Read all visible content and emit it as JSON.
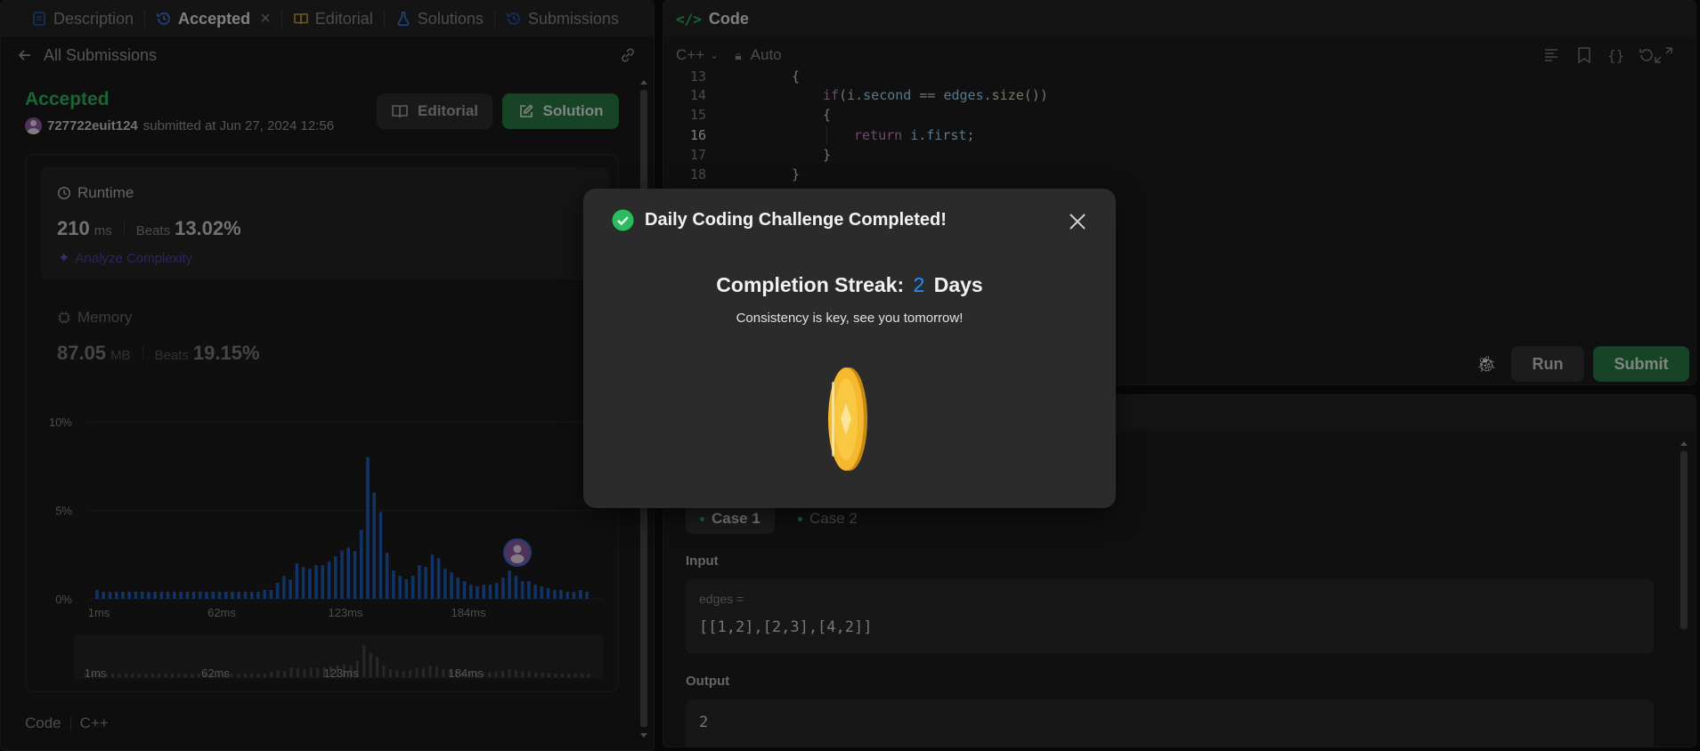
{
  "left_tabs": [
    {
      "label": "Description",
      "icon": "description-icon",
      "active": false
    },
    {
      "label": "Accepted",
      "icon": "history-icon",
      "active": true,
      "closable": true
    },
    {
      "label": "Editorial",
      "icon": "book-icon",
      "active": false
    },
    {
      "label": "Solutions",
      "icon": "flask-icon",
      "active": false
    },
    {
      "label": "Submissions",
      "icon": "history-icon",
      "active": false
    }
  ],
  "submission": {
    "back_label": "All Submissions",
    "status": "Accepted",
    "username": "727722euit124",
    "submitted_text": "submitted at Jun 27, 2024 12:56",
    "editorial_button": "Editorial",
    "solution_button": "Solution"
  },
  "runtime": {
    "label": "Runtime",
    "value": "210",
    "unit": "ms",
    "beats_label": "Beats",
    "beats_value": "13.02%",
    "analyze_label": "Analyze Complexity"
  },
  "memory": {
    "label": "Memory",
    "value": "87.05",
    "unit": "MB",
    "beats_label": "Beats",
    "beats_value": "19.15%"
  },
  "chart_data": {
    "type": "bar",
    "y_ticks": [
      "10%",
      "5%",
      "0%"
    ],
    "ylim": [
      0,
      10
    ],
    "x_ticks": [
      "1ms",
      "62ms",
      "123ms",
      "184ms"
    ],
    "mini_x_ticks": [
      "1ms",
      "62ms",
      "123ms",
      "184ms"
    ],
    "values": [
      0.5,
      0.4,
      0.4,
      0.4,
      0.4,
      0.4,
      0.4,
      0.4,
      0.4,
      0.4,
      0.4,
      0.4,
      0.4,
      0.4,
      0.4,
      0.4,
      0.4,
      0.4,
      0.4,
      0.4,
      0.4,
      0.4,
      0.4,
      0.4,
      0.4,
      0.4,
      0.5,
      0.5,
      0.9,
      1.3,
      1.1,
      2.0,
      1.8,
      1.7,
      1.9,
      1.9,
      2.1,
      2.4,
      2.7,
      2.9,
      2.7,
      3.9,
      8.0,
      6.0,
      4.9,
      2.6,
      1.6,
      1.3,
      1.1,
      1.3,
      1.9,
      1.8,
      2.5,
      2.3,
      1.7,
      1.5,
      1.2,
      1.0,
      0.8,
      0.7,
      0.8,
      0.8,
      0.9,
      1.2,
      1.6,
      1.3,
      1.0,
      1.0,
      0.8,
      0.7,
      0.6,
      0.5,
      0.5,
      0.4,
      0.4,
      0.5,
      0.4
    ],
    "bar_color": "#1e5fbd",
    "highlight_index": 64
  },
  "left_footer": {
    "code_label": "Code",
    "lang_label": "C++"
  },
  "code_panel": {
    "title": "Code",
    "language": "C++",
    "mode": "Auto",
    "lines": [
      {
        "n": "13",
        "text": "{"
      },
      {
        "n": "14",
        "text": "if(i.second == edges.size())"
      },
      {
        "n": "15",
        "text": "{"
      },
      {
        "n": "16",
        "text": "return i.first;"
      },
      {
        "n": "17",
        "text": "}"
      },
      {
        "n": "18",
        "text": "}"
      }
    ],
    "run_label": "Run",
    "submit_label": "Submit"
  },
  "test_panel": {
    "cases": [
      "Case 1",
      "Case 2"
    ],
    "input_label": "Input",
    "input_var": "edges =",
    "input_value": "[[1,2],[2,3],[4,2]]",
    "output_label": "Output",
    "output_value": "2"
  },
  "modal": {
    "title": "Daily Coding Challenge Completed!",
    "streak_prefix": "Completion Streak:",
    "streak_number": "2",
    "streak_suffix": "Days",
    "subtitle": "Consistency is key, see you tomorrow!"
  },
  "colors": {
    "accent_green": "#2cbb5d",
    "accent_blue": "#1e90ff",
    "coin": "#f5b82e"
  }
}
